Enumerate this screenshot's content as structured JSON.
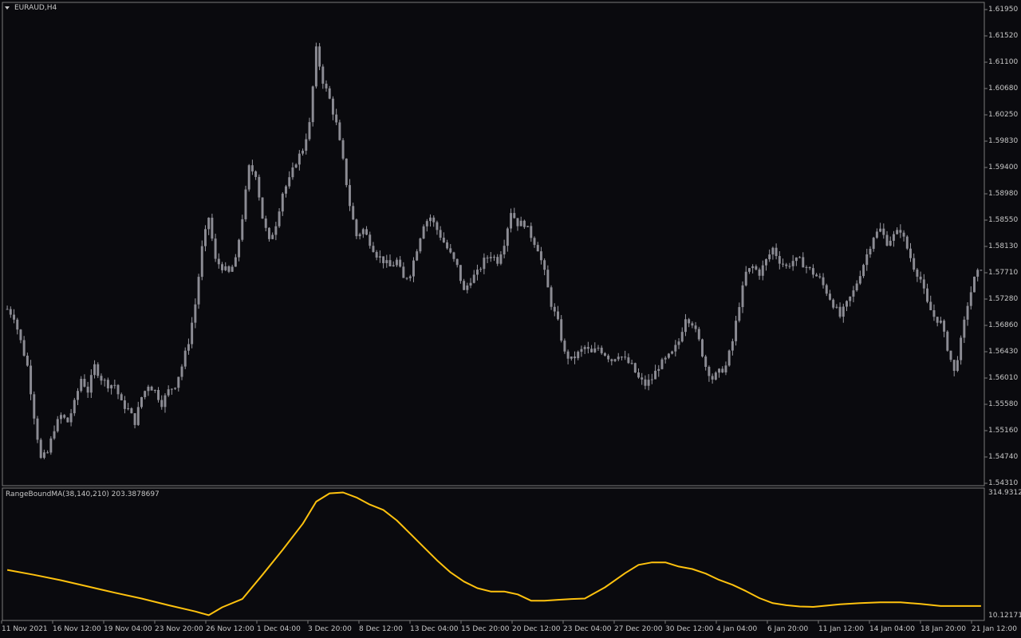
{
  "main_chart": {
    "symbol_label": "EURAUD,H4",
    "price_axis_labels": [
      "1.61950",
      "1.61520",
      "1.61100",
      "1.60680",
      "1.60250",
      "1.59830",
      "1.59400",
      "1.58980",
      "1.58550",
      "1.58130",
      "1.57710",
      "1.57280",
      "1.56860",
      "1.56430",
      "1.56010",
      "1.55580",
      "1.55160",
      "1.54740",
      "1.54310"
    ],
    "time_axis_labels": [
      "11 Nov 2021",
      "16 Nov 12:00",
      "19 Nov 04:00",
      "23 Nov 20:00",
      "26 Nov 12:00",
      "1 Dec 04:00",
      "3 Dec 20:00",
      "8 Dec 12:00",
      "13 Dec 04:00",
      "15 Dec 20:00",
      "20 Dec 12:00",
      "23 Dec 04:00",
      "27 Dec 20:00",
      "30 Dec 12:00",
      "4 Jan 04:00",
      "6 Jan 20:00",
      "11 Jan 12:00",
      "14 Jan 04:00",
      "18 Jan 20:00",
      "21 Jan 12:00"
    ]
  },
  "indicator": {
    "label": "RangeBoundMA(38,140,210) 203.3878697",
    "axis_top": "314.93127",
    "axis_bottom": "10.12171"
  },
  "colors": {
    "background": "#0a0a0e",
    "candle": "#8c8c94",
    "wick": "#9a9aa2",
    "indicator_line": "#ffc20e",
    "axis_text": "#c8c8c8",
    "border": "#7a7a7a"
  },
  "chart_data": [
    {
      "type": "candlestick",
      "title": "EURAUD,H4",
      "ylim": [
        1.5431,
        1.6195
      ],
      "approx_close_path": [
        [
          0,
          1.5712
        ],
        [
          2,
          1.57
        ],
        [
          4,
          1.566
        ],
        [
          6,
          1.562
        ],
        [
          8,
          1.554
        ],
        [
          10,
          1.547
        ],
        [
          12,
          1.548
        ],
        [
          14,
          1.552
        ],
        [
          16,
          1.554
        ],
        [
          18,
          1.553
        ],
        [
          20,
          1.556
        ],
        [
          22,
          1.56
        ],
        [
          24,
          1.558
        ],
        [
          26,
          1.562
        ],
        [
          28,
          1.56
        ],
        [
          30,
          1.559
        ],
        [
          32,
          1.559
        ],
        [
          34,
          1.556
        ],
        [
          36,
          1.555
        ],
        [
          38,
          1.553
        ],
        [
          40,
          1.557
        ],
        [
          42,
          1.559
        ],
        [
          44,
          1.558
        ],
        [
          46,
          1.556
        ],
        [
          48,
          1.558
        ],
        [
          50,
          1.559
        ],
        [
          52,
          1.562
        ],
        [
          54,
          1.566
        ],
        [
          56,
          1.572
        ],
        [
          58,
          1.581
        ],
        [
          60,
          1.586
        ],
        [
          62,
          1.579
        ],
        [
          64,
          1.578
        ],
        [
          66,
          1.577
        ],
        [
          68,
          1.579
        ],
        [
          70,
          1.586
        ],
        [
          72,
          1.594
        ],
        [
          74,
          1.593
        ],
        [
          76,
          1.586
        ],
        [
          78,
          1.582
        ],
        [
          80,
          1.585
        ],
        [
          82,
          1.59
        ],
        [
          84,
          1.592
        ],
        [
          86,
          1.595
        ],
        [
          88,
          1.597
        ],
        [
          90,
          1.601
        ],
        [
          92,
          1.613
        ],
        [
          94,
          1.608
        ],
        [
          96,
          1.605
        ],
        [
          98,
          1.601
        ],
        [
          100,
          1.595
        ],
        [
          102,
          1.588
        ],
        [
          104,
          1.583
        ],
        [
          106,
          1.584
        ],
        [
          108,
          1.582
        ],
        [
          110,
          1.58
        ],
        [
          112,
          1.579
        ],
        [
          114,
          1.578
        ],
        [
          116,
          1.579
        ],
        [
          118,
          1.576
        ],
        [
          120,
          1.577
        ],
        [
          122,
          1.581
        ],
        [
          124,
          1.585
        ],
        [
          126,
          1.586
        ],
        [
          128,
          1.584
        ],
        [
          130,
          1.582
        ],
        [
          132,
          1.58
        ],
        [
          134,
          1.578
        ],
        [
          136,
          1.574
        ],
        [
          138,
          1.576
        ],
        [
          140,
          1.577
        ],
        [
          142,
          1.579
        ],
        [
          144,
          1.58
        ],
        [
          146,
          1.579
        ],
        [
          148,
          1.582
        ],
        [
          150,
          1.587
        ],
        [
          152,
          1.585
        ],
        [
          154,
          1.585
        ],
        [
          156,
          1.583
        ],
        [
          158,
          1.581
        ],
        [
          160,
          1.577
        ],
        [
          162,
          1.572
        ],
        [
          164,
          1.569
        ],
        [
          166,
          1.564
        ],
        [
          168,
          1.563
        ],
        [
          170,
          1.564
        ],
        [
          172,
          1.565
        ],
        [
          174,
          1.564
        ],
        [
          176,
          1.565
        ],
        [
          178,
          1.564
        ],
        [
          180,
          1.563
        ],
        [
          182,
          1.564
        ],
        [
          184,
          1.563
        ],
        [
          186,
          1.562
        ],
        [
          188,
          1.56
        ],
        [
          190,
          1.559
        ],
        [
          192,
          1.56
        ],
        [
          194,
          1.562
        ],
        [
          196,
          1.563
        ],
        [
          198,
          1.564
        ],
        [
          200,
          1.566
        ],
        [
          202,
          1.57
        ],
        [
          204,
          1.569
        ],
        [
          206,
          1.566
        ],
        [
          208,
          1.562
        ],
        [
          210,
          1.56
        ],
        [
          212,
          1.561
        ],
        [
          214,
          1.562
        ],
        [
          216,
          1.566
        ],
        [
          218,
          1.572
        ],
        [
          220,
          1.577
        ],
        [
          222,
          1.578
        ],
        [
          224,
          1.577
        ],
        [
          226,
          1.579
        ],
        [
          228,
          1.581
        ],
        [
          230,
          1.579
        ],
        [
          232,
          1.578
        ],
        [
          234,
          1.579
        ],
        [
          236,
          1.579
        ],
        [
          238,
          1.578
        ],
        [
          240,
          1.577
        ],
        [
          242,
          1.576
        ],
        [
          244,
          1.574
        ],
        [
          246,
          1.572
        ],
        [
          248,
          1.57
        ],
        [
          250,
          1.572
        ],
        [
          252,
          1.574
        ],
        [
          254,
          1.577
        ],
        [
          256,
          1.58
        ],
        [
          258,
          1.583
        ],
        [
          260,
          1.584
        ],
        [
          262,
          1.582
        ],
        [
          264,
          1.583
        ],
        [
          266,
          1.584
        ],
        [
          268,
          1.581
        ],
        [
          270,
          1.578
        ],
        [
          272,
          1.576
        ],
        [
          274,
          1.572
        ],
        [
          276,
          1.57
        ],
        [
          278,
          1.569
        ],
        [
          280,
          1.565
        ],
        [
          282,
          1.561
        ],
        [
          284,
          1.566
        ],
        [
          286,
          1.572
        ],
        [
          288,
          1.576
        ],
        [
          290,
          1.578
        ]
      ]
    },
    {
      "type": "line",
      "title": "RangeBoundMA(38,140,210) 203.3878697",
      "ylim": [
        10.12171,
        314.93127
      ],
      "series": [
        {
          "name": "RangeBoundMA(38,140,210)",
          "x": [
            0,
            8,
            16,
            24,
            32,
            40,
            48,
            56,
            60,
            64,
            70,
            76,
            82,
            88,
            92,
            96,
            100,
            104,
            108,
            112,
            116,
            120,
            124,
            128,
            132,
            136,
            140,
            144,
            148,
            152,
            156,
            160,
            164,
            168,
            172,
            178,
            184,
            188,
            192,
            196,
            200,
            204,
            208,
            212,
            216,
            220,
            224,
            228,
            232,
            236,
            240,
            244,
            248,
            254,
            260,
            266,
            272,
            278,
            284,
            288,
            290
          ],
          "values": [
            126,
            114,
            101,
            86,
            71,
            57,
            41,
            26,
            17,
            36,
            56,
            114,
            174,
            237,
            290,
            310,
            312,
            300,
            283,
            270,
            245,
            213,
            181,
            149,
            120,
            98,
            82,
            74,
            74,
            67,
            52,
            52,
            54,
            56,
            57,
            84,
            118,
            138,
            144,
            144,
            134,
            128,
            117,
            102,
            90,
            75,
            58,
            46,
            41,
            38,
            37,
            40,
            43,
            46,
            48,
            48,
            44,
            39,
            39,
            39,
            39
          ]
        }
      ]
    }
  ]
}
